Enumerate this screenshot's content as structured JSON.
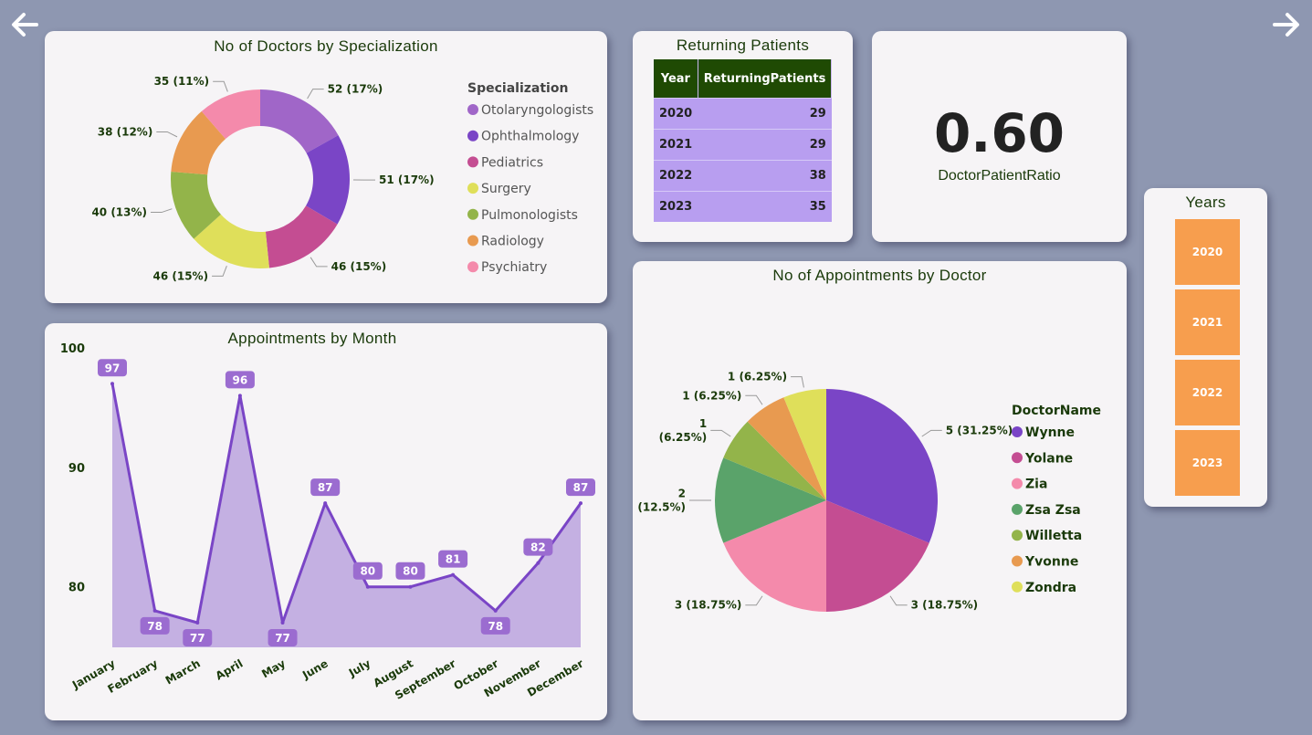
{
  "nav": {
    "back_icon": "arrow-left-icon",
    "forward_icon": "arrow-right-icon"
  },
  "specialization_card": {
    "title": "No of Doctors by Specialization"
  },
  "returning_card": {
    "title": "Returning Patients",
    "col_year": "Year",
    "col_value": "ReturningPatients",
    "rows": [
      {
        "year": "2020",
        "value": "29"
      },
      {
        "year": "2021",
        "value": "29"
      },
      {
        "year": "2022",
        "value": "38"
      },
      {
        "year": "2023",
        "value": "35"
      }
    ]
  },
  "kpi_card": {
    "value": "0.60",
    "label": "DoctorPatientRatio"
  },
  "years_slicer": {
    "title": "Years",
    "options": [
      "2020",
      "2021",
      "2022",
      "2023"
    ]
  },
  "month_card": {
    "title": "Appointments by Month"
  },
  "doctor_card": {
    "title": "No of Appointments by Doctor"
  },
  "chart_data": [
    {
      "type": "pie",
      "variant": "donut",
      "title": "No of Doctors by Specialization",
      "legend_title": "Specialization",
      "legend_position": "right",
      "categories": [
        "Otolaryngologists",
        "Ophthalmology",
        "Pediatrics",
        "Surgery",
        "Pulmonologists",
        "Radiology",
        "Psychiatry"
      ],
      "values": [
        52,
        51,
        46,
        46,
        40,
        38,
        35
      ],
      "labels": [
        "52 (17%)",
        "51 (17%)",
        "46 (15%)",
        "46 (15%)",
        "40 (13%)",
        "38 (12%)",
        "35 (11%)"
      ],
      "colors": [
        "#a066c8",
        "#7a45c6",
        "#c44d92",
        "#dfdf5a",
        "#93b44a",
        "#e89a50",
        "#f48aab"
      ]
    },
    {
      "type": "area",
      "title": "Appointments by Month",
      "categories": [
        "January",
        "February",
        "March",
        "April",
        "May",
        "June",
        "July",
        "August",
        "September",
        "October",
        "November",
        "December"
      ],
      "values": [
        97,
        78,
        77,
        96,
        77,
        87,
        80,
        80,
        81,
        78,
        82,
        87
      ],
      "y_ticks": [
        80,
        90,
        100
      ],
      "ylim": [
        77,
        100
      ],
      "color": "#7a45c6"
    },
    {
      "type": "pie",
      "title": "No of Appointments by Doctor",
      "legend_title": "DoctorName",
      "legend_position": "right",
      "categories": [
        "Wynne",
        "Yolane",
        "Zia",
        "Zsa Zsa",
        "Willetta",
        "Yvonne",
        "Zondra"
      ],
      "values": [
        5,
        3,
        3,
        2,
        1,
        1,
        1
      ],
      "labels": [
        [
          "5 (31.25%)"
        ],
        [
          "3 (18.75%)"
        ],
        [
          "3 (18.75%)"
        ],
        [
          "2",
          "(12.5%)"
        ],
        [
          "1",
          "(6.25%)"
        ],
        [
          "1 (6.25%)"
        ],
        [
          "1 (6.25%)"
        ]
      ],
      "colors": [
        "#7a45c6",
        "#c44d92",
        "#f48aab",
        "#5aa36a",
        "#93b44a",
        "#e89a50",
        "#dfdf5a"
      ]
    }
  ]
}
